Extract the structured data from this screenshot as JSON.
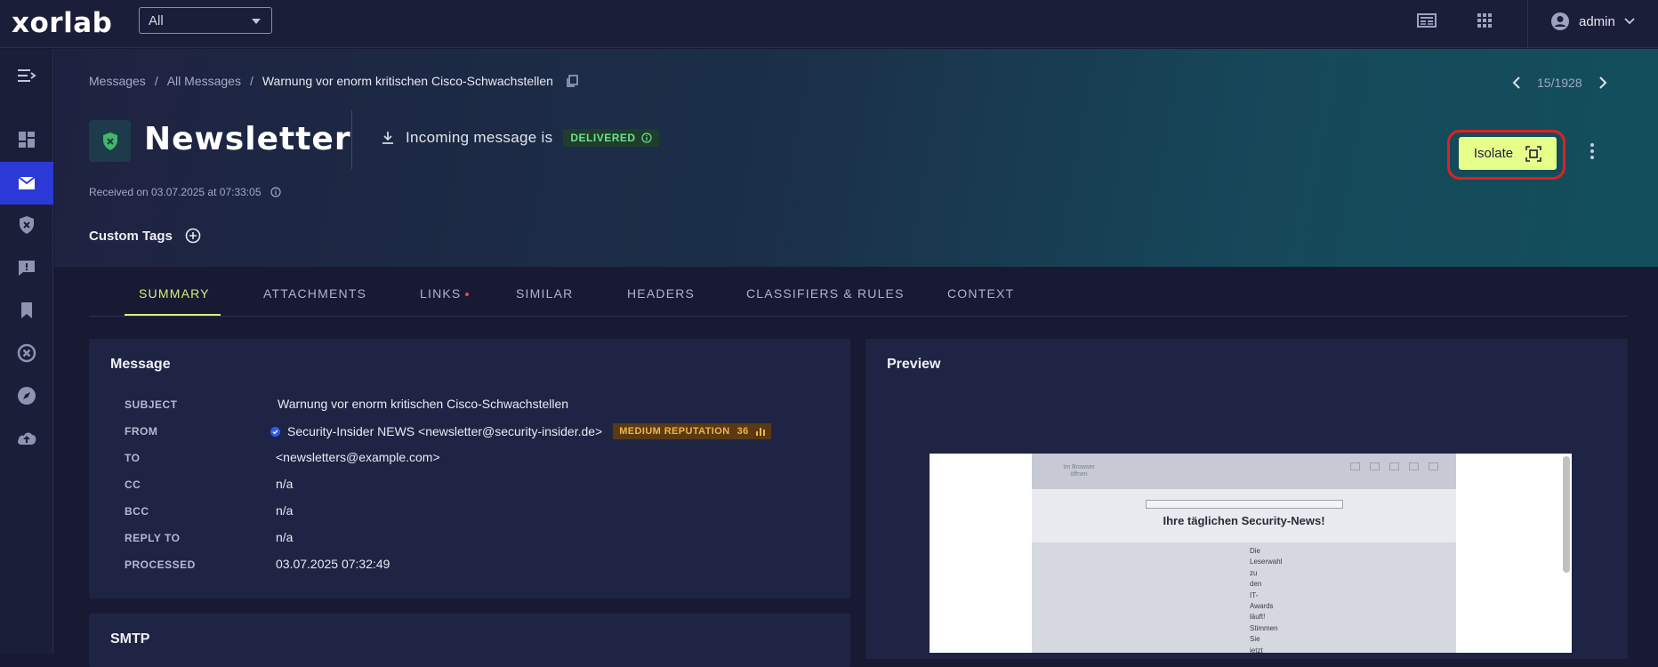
{
  "app": {
    "logo": "xorlab"
  },
  "scope_select": {
    "value": "All"
  },
  "user": {
    "name": "admin"
  },
  "breadcrumb": {
    "items": [
      "Messages",
      "All Messages"
    ],
    "separator": "/",
    "current": "Warnung vor enorm kritischen Cisco-Schwachstellen"
  },
  "pager": {
    "position": "15/1928"
  },
  "header": {
    "title": "Newsletter",
    "incoming_text": "Incoming message is",
    "status_badge": "DELIVERED",
    "received": "Received on 03.07.2025 at 07:33:05",
    "custom_tags_label": "Custom Tags",
    "isolate_label": "Isolate"
  },
  "tabs": [
    {
      "label": "SUMMARY",
      "active": true
    },
    {
      "label": "ATTACHMENTS"
    },
    {
      "label": "LINKS",
      "has_dot": true
    },
    {
      "label": "SIMILAR"
    },
    {
      "label": "HEADERS"
    },
    {
      "label": "CLASSIFIERS & RULES"
    },
    {
      "label": "CONTEXT"
    }
  ],
  "message_panel": {
    "title": "Message",
    "rows": [
      {
        "label": "SUBJECT",
        "value": "Warnung vor enorm kritischen Cisco-Schwachstellen"
      },
      {
        "label": "FROM",
        "value": "Security-Insider NEWS <newsletter@security-insider.de>",
        "reputation": "MEDIUM REPUTATION",
        "reputation_score": "36"
      },
      {
        "label": "TO",
        "value": "<newsletters@example.com>"
      },
      {
        "label": "CC",
        "value": "n/a"
      },
      {
        "label": "BCC",
        "value": "n/a"
      },
      {
        "label": "REPLY TO",
        "value": "n/a"
      },
      {
        "label": "PROCESSED",
        "value": "03.07.2025 07:32:49"
      }
    ]
  },
  "smtp_panel": {
    "title": "SMTP"
  },
  "preview_panel": {
    "title": "Preview",
    "browser_link": "Im Browser öffnen",
    "headline": "Ihre täglichen Security-News!",
    "body_words": [
      "Die",
      "Leserwahl",
      "zu",
      "den",
      "IT-",
      "Awards",
      "läuft!",
      "Stimmen",
      "Sie",
      "jetzt"
    ]
  },
  "colors": {
    "accent_active": "#2b3ad6",
    "tab_active": "#d9ee7c",
    "isolate_button": "#e6ff8a",
    "highlight_ring": "#e02020",
    "delivered": "#6ee08c",
    "reputation_medium": "#f0b250"
  }
}
